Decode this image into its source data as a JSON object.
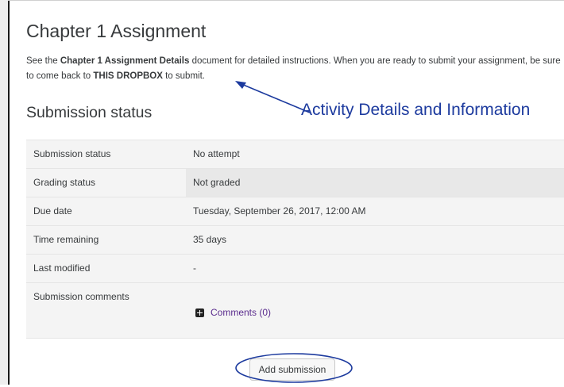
{
  "page": {
    "title": "Chapter 1 Assignment",
    "intro": {
      "text_1": "See the ",
      "bold_1": "Chapter 1 Assignment Details",
      "text_2": " document for detailed instructions. When you are ready to submit your assignment, be sure to come back to ",
      "bold_2": "THIS DROPBOX",
      "text_3": " to submit."
    },
    "section_heading": "Submission status"
  },
  "annotation": {
    "label": "Activity Details and Information",
    "color": "#1c3a9e"
  },
  "status_table": {
    "rows": [
      {
        "label": "Submission status",
        "value": "No attempt"
      },
      {
        "label": "Grading status",
        "value": "Not graded"
      },
      {
        "label": "Due date",
        "value": "Tuesday, September 26, 2017, 12:00 AM"
      },
      {
        "label": "Time remaining",
        "value": "35 days"
      },
      {
        "label": "Last modified",
        "value": "-"
      },
      {
        "label": "Submission comments",
        "comments_link": "Comments (0)",
        "icon": "plus-square-icon"
      }
    ]
  },
  "actions": {
    "add_submission": "Add submission"
  },
  "colors": {
    "link": "#5b2d8e",
    "highlight_ring": "#1c3a9e"
  }
}
